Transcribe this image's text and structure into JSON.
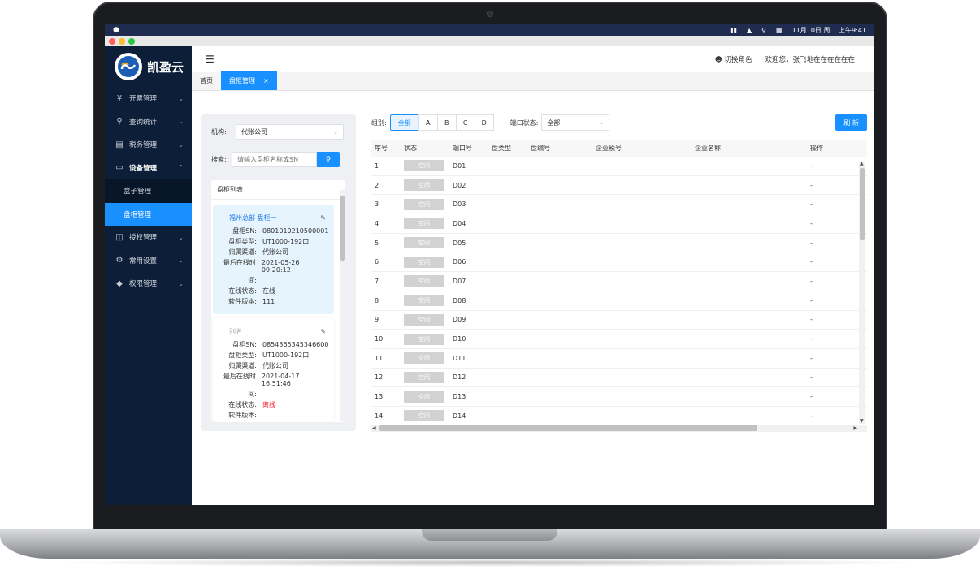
{
  "mac_menubar": {
    "apple": "",
    "datetime": "11月10日 周二 上午9:41"
  },
  "app": {
    "logo_text": "凯盈云"
  },
  "sidebar": {
    "items": [
      {
        "label": "开票管理",
        "icon": "yen-icon"
      },
      {
        "label": "查询统计",
        "icon": "search-icon"
      },
      {
        "label": "税务管理",
        "icon": "box-icon"
      },
      {
        "label": "设备管理",
        "icon": "monitor-icon",
        "open": true
      },
      {
        "label": "授权管理",
        "icon": "grid-icon"
      },
      {
        "label": "常用设置",
        "icon": "gear-icon"
      },
      {
        "label": "权限管理",
        "icon": "shield-icon"
      }
    ],
    "sub_items": [
      {
        "label": "盒子管理"
      },
      {
        "label": "盘柜管理",
        "active": true
      }
    ]
  },
  "topbar": {
    "switch_role": "切换角色",
    "welcome": "欢迎您，张飞地在在在在在在"
  },
  "tabs": [
    {
      "label": "首页"
    },
    {
      "label": "盘柜管理",
      "close": "×"
    }
  ],
  "left_panel": {
    "org_label": "机构:",
    "org_value": "代账公司",
    "search_label": "搜索:",
    "search_placeholder": "请输入盘柜名称或SN",
    "list_title": "盘柜列表",
    "cards": [
      {
        "title": "福州总部 盘柜一",
        "rows": [
          {
            "k": "盘柜SN:",
            "v": "0801010210500001"
          },
          {
            "k": "盘柜类型:",
            "v": "UT1000-192口"
          },
          {
            "k": "归属渠道:",
            "v": "代账公司"
          },
          {
            "k": "最后在线时",
            "v": "2021-05-26 09:20:12"
          },
          {
            "k": "间:",
            "v": ""
          },
          {
            "k": "在线状态:",
            "v": "在线"
          },
          {
            "k": "软件版本:",
            "v": "111"
          }
        ]
      },
      {
        "title": "别名",
        "rows": [
          {
            "k": "盘柜SN:",
            "v": "0854365345346600"
          },
          {
            "k": "盘柜类型:",
            "v": "UT1000-192口"
          },
          {
            "k": "归属渠道:",
            "v": "代账公司"
          },
          {
            "k": "最后在线时",
            "v": "2021-04-17 16:51:46"
          },
          {
            "k": "间:",
            "v": ""
          },
          {
            "k": "在线状态:",
            "v": "离线"
          },
          {
            "k": "软件版本:",
            "v": ""
          }
        ]
      }
    ]
  },
  "filters": {
    "group_label": "组别:",
    "groups": [
      "全部",
      "A",
      "B",
      "C",
      "D"
    ],
    "port_status_label": "端口状态:",
    "port_status_value": "全部",
    "refresh": "刷 新"
  },
  "table": {
    "headers": [
      "序号",
      "状态",
      "端口号",
      "盘类型",
      "盘编号",
      "企业税号",
      "企业名称",
      "操作"
    ],
    "rows": [
      {
        "no": "1",
        "status": "空闲",
        "port": "D01",
        "op": "-"
      },
      {
        "no": "2",
        "status": "空闲",
        "port": "D02",
        "op": "-"
      },
      {
        "no": "3",
        "status": "空闲",
        "port": "D03",
        "op": "-"
      },
      {
        "no": "4",
        "status": "空闲",
        "port": "D04",
        "op": "-"
      },
      {
        "no": "5",
        "status": "空闲",
        "port": "D05",
        "op": "-"
      },
      {
        "no": "6",
        "status": "空闲",
        "port": "D06",
        "op": "-"
      },
      {
        "no": "7",
        "status": "空闲",
        "port": "D07",
        "op": "-"
      },
      {
        "no": "8",
        "status": "空闲",
        "port": "D08",
        "op": "-"
      },
      {
        "no": "9",
        "status": "空闲",
        "port": "D09",
        "op": "-"
      },
      {
        "no": "10",
        "status": "空闲",
        "port": "D10",
        "op": "-"
      },
      {
        "no": "11",
        "status": "空闲",
        "port": "D11",
        "op": "-"
      },
      {
        "no": "12",
        "status": "空闲",
        "port": "D12",
        "op": "-"
      },
      {
        "no": "13",
        "status": "空闲",
        "port": "D13",
        "op": "-"
      },
      {
        "no": "14",
        "status": "空闲",
        "port": "D14",
        "op": "-"
      }
    ]
  },
  "colors": {
    "primary": "#1890ff",
    "sidebar": "#0c1e38",
    "offline": "#f5222d"
  }
}
